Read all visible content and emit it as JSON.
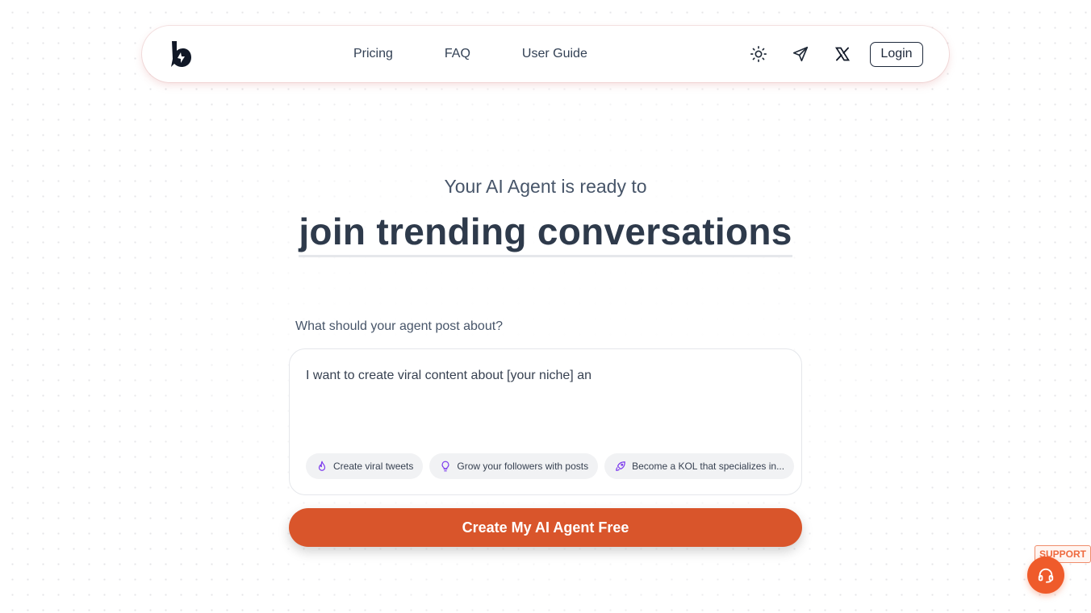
{
  "header": {
    "nav": [
      {
        "label": "Pricing"
      },
      {
        "label": "FAQ"
      },
      {
        "label": "User Guide"
      }
    ],
    "login_label": "Login"
  },
  "hero": {
    "subtitle": "Your AI Agent is ready to",
    "title": "join trending conversations"
  },
  "prompt": {
    "label": "What should your agent post about?",
    "value": "I want to create viral content about [your niche] an",
    "suggestions": [
      {
        "label": "Create viral tweets",
        "icon": "flame-icon"
      },
      {
        "label": "Grow your followers with posts",
        "icon": "lightbulb-icon"
      },
      {
        "label": "Become a KOL that specializes in...",
        "icon": "rocket-icon"
      }
    ]
  },
  "cta": {
    "label": "Create My AI Agent Free"
  },
  "support": {
    "label": "SUPPORT"
  },
  "colors": {
    "accent": "#d9552b",
    "support": "#ef5b2b",
    "chip_icon": "#7c3aed",
    "text": "#334155"
  }
}
